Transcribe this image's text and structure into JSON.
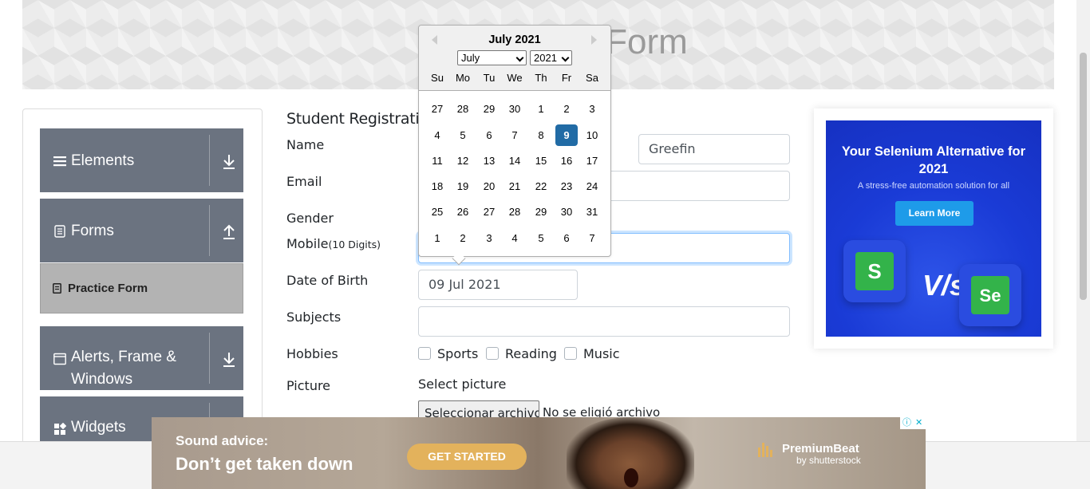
{
  "header": {
    "title": "Practice Form"
  },
  "sidebar": {
    "groups": [
      {
        "label": "Elements",
        "icon": "hamburger-icon",
        "arrow": "download-arrow-icon"
      },
      {
        "label": "Forms",
        "icon": "document-icon",
        "arrow": "upload-arrow-icon"
      },
      {
        "label": "Alerts, Frame & Windows",
        "icon": "window-icon",
        "arrow": "download-arrow-icon"
      },
      {
        "label": "Widgets",
        "icon": "widgets-icon",
        "arrow": "download-arrow-icon"
      }
    ],
    "active_item": {
      "label": "Practice Form",
      "icon": "form-icon"
    }
  },
  "form": {
    "heading": "Student Registration Form",
    "labels": {
      "name": "Name",
      "email": "Email",
      "gender": "Gender",
      "mobile": "Mobile",
      "mobile_hint": "(10 Digits)",
      "dob": "Date of Birth",
      "subjects": "Subjects",
      "hobbies": "Hobbies",
      "picture": "Picture"
    },
    "last_name_value": "Greefin",
    "dob_value": "09 Jul 2021",
    "hobbies": [
      "Sports",
      "Reading",
      "Music"
    ],
    "select_picture": "Select picture",
    "file_button": "Seleccionar archivo",
    "file_status": "No se eligió archivo"
  },
  "datepicker": {
    "title": "July 2021",
    "month_selected": "July",
    "year_selected": "2021",
    "day_names": [
      "Su",
      "Mo",
      "Tu",
      "We",
      "Th",
      "Fr",
      "Sa"
    ],
    "weeks": [
      [
        "27",
        "28",
        "29",
        "30",
        "1",
        "2",
        "3"
      ],
      [
        "4",
        "5",
        "6",
        "7",
        "8",
        "9",
        "10"
      ],
      [
        "11",
        "12",
        "13",
        "14",
        "15",
        "16",
        "17"
      ],
      [
        "18",
        "19",
        "20",
        "21",
        "22",
        "23",
        "24"
      ],
      [
        "25",
        "26",
        "27",
        "28",
        "29",
        "30",
        "31"
      ],
      [
        "1",
        "2",
        "3",
        "4",
        "5",
        "6",
        "7"
      ]
    ],
    "selected_day": "9",
    "selected_color": "#216ba5"
  },
  "ad_right": {
    "title": "Your Selenium Alternative for 2021",
    "subtitle": "A stress-free automation solution for all",
    "button": "Learn More",
    "vs_text": "V/s",
    "left_logo": "S",
    "right_logo": "Se"
  },
  "ad_bottom": {
    "line1": "Sound advice:",
    "line2": "Don’t get taken down",
    "button": "GET STARTED",
    "brand": "PremiumBeat",
    "brand_sub": "by shutterstock"
  },
  "colors": {
    "menu_header": "#6b7380",
    "menu_active": "#b3b3b3",
    "ad_blue": "#1a3bd6",
    "focus_border": "#80bdff"
  }
}
